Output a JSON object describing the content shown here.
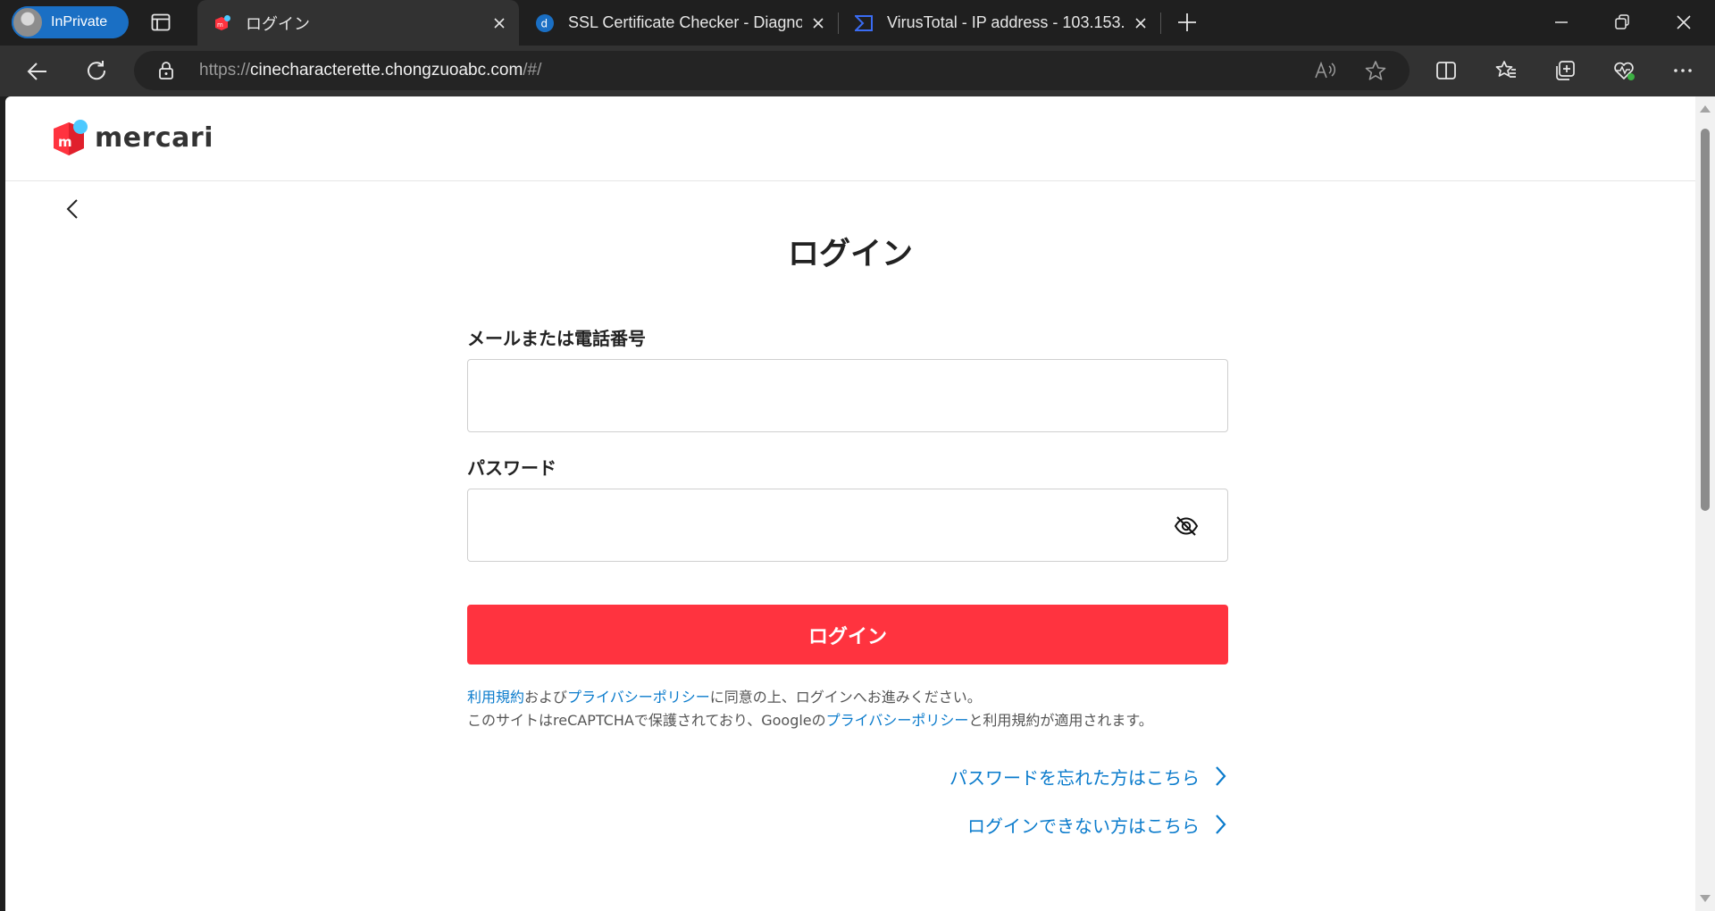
{
  "browser": {
    "inprivate_label": "InPrivate",
    "tabs": [
      {
        "title": "ログイン",
        "close": "×"
      },
      {
        "title": "SSL Certificate Checker - Diagnos",
        "close": "×"
      },
      {
        "title": "VirusTotal - IP address - 103.153.",
        "close": "×"
      }
    ],
    "url_scheme": "https://",
    "url_host": "cinecharacterette.chongzuoabc.com",
    "url_path": "/#/",
    "icons": {
      "back": "back-arrow-icon",
      "refresh": "refresh-icon",
      "lock": "lock-icon",
      "read_aloud": "read-aloud-icon",
      "favorite": "star-icon",
      "split": "split-screen-icon",
      "favorites": "favorites-icon",
      "collections": "collections-icon",
      "health": "browser-essentials-icon",
      "more": "more-icon"
    },
    "accent": "#1a6fc4"
  },
  "site": {
    "brand": "mercari",
    "brand_color": "#ff333f",
    "page_title": "ログイン",
    "email_label": "メールまたは電話番号",
    "email_value": "",
    "password_label": "パスワード",
    "password_value": "",
    "login_button": "ログイン",
    "legal": {
      "terms": "利用規約",
      "and": "および",
      "privacy": "プライバシーポリシー",
      "agree": "に同意の上、ログインへお進みください。",
      "recaptcha_prefix": "このサイトはreCAPTCHAで保護されており、Googleの",
      "recaptcha_privacy": "プライバシーポリシー",
      "recaptcha_suffix": "と利用規約が適用されます。"
    },
    "forgot_password": "パスワードを忘れた方はこちら",
    "cannot_login": "ログインできない方はこちら",
    "link_color": "#0a7bcc"
  }
}
